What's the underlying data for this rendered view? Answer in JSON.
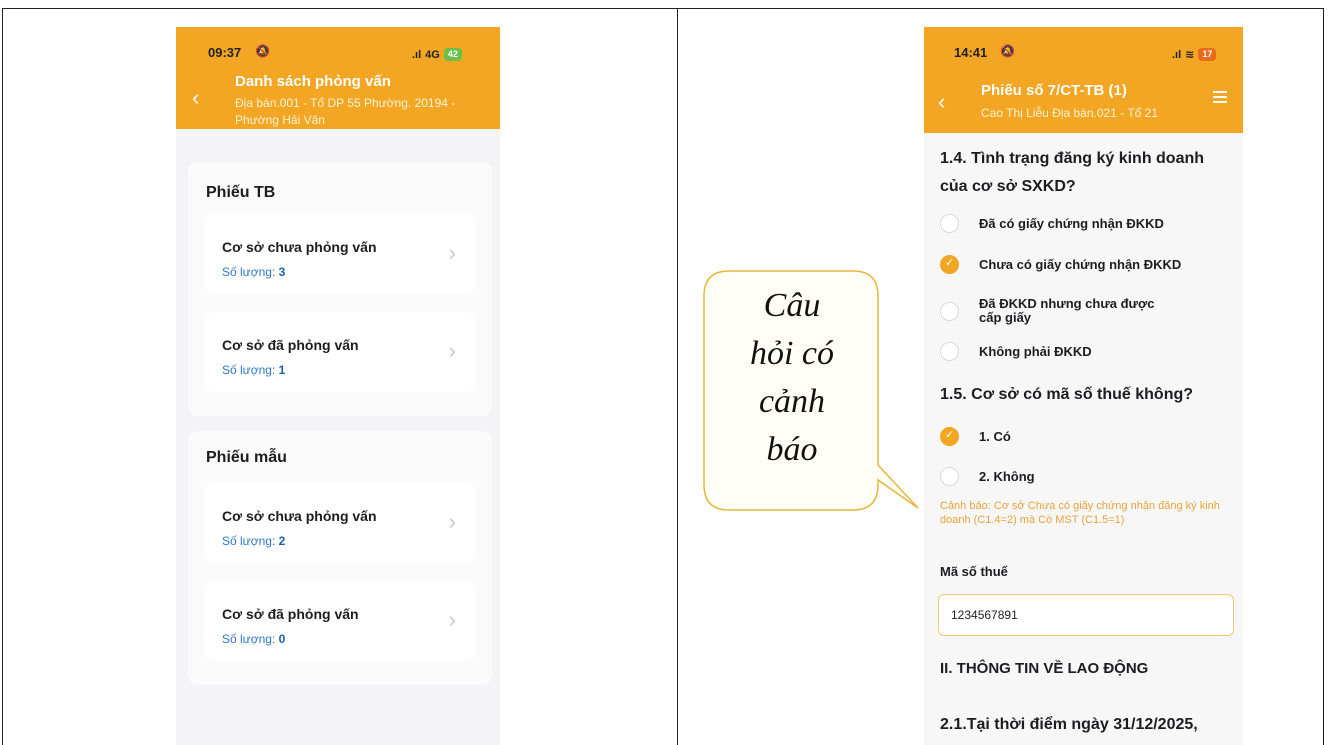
{
  "left_phone": {
    "status_time": "09:37",
    "status_network": "4G",
    "status_battery": "42",
    "title": "Danh sách phỏng vấn",
    "subtitle": "Địa bàn.001 - Tổ DP 55 Phường. 20194 - Phường Hải Vân",
    "groups": [
      {
        "title": "Phiếu TB",
        "items": [
          {
            "title": "Cơ sở chưa phỏng vấn",
            "count_label": "Số lượng:",
            "count": "3"
          },
          {
            "title": "Cơ sở đã phỏng vấn",
            "count_label": "Số lượng:",
            "count": "1"
          }
        ]
      },
      {
        "title": "Phiếu mẫu",
        "items": [
          {
            "title": "Cơ sở chưa phỏng vấn",
            "count_label": "Số lượng:",
            "count": "2"
          },
          {
            "title": "Cơ sở đã phỏng vấn",
            "count_label": "Số lượng:",
            "count": "0"
          }
        ]
      }
    ]
  },
  "right_phone": {
    "status_time": "14:41",
    "status_battery": "17",
    "title": "Phiếu số 7/CT-TB (1)",
    "subtitle": "Cao Thị Liễu Địa bàn.021 - Tổ 21",
    "q14": {
      "text": "1.4. Tình trạng đăng ký kinh doanh của cơ sở SXKD?",
      "options": [
        {
          "label": "Đã có giấy chứng nhận ĐKKD",
          "checked": false
        },
        {
          "label": "Chưa có giấy chứng nhận ĐKKD",
          "checked": true
        },
        {
          "label": "Đã ĐKKD nhưng chưa được cấp giấy",
          "checked": false
        },
        {
          "label": "Không phải ĐKKD",
          "checked": false
        }
      ]
    },
    "q15": {
      "text": "1.5. Cơ sở có mã số thuế không?",
      "options": [
        {
          "label": "1. Có",
          "checked": true
        },
        {
          "label": "2. Không",
          "checked": false
        }
      ]
    },
    "warning": "Cảnh báo: Cơ sở Chưa có giấy chứng nhận đăng ký kinh doanh (C1.4=2) mà Có MST (C1.5=1)",
    "tax_label": "Mã số thuế",
    "tax_value": "1234567891",
    "section_title": "II. THÔNG TIN VỀ LAO ĐỘNG",
    "q21_text": "2.1.Tại thời điểm ngày 31/12/2025,"
  },
  "callout": {
    "line1": "Câu",
    "line2": "hỏi có",
    "line3": "cảnh",
    "line4": "báo"
  },
  "colors": {
    "accent": "#f2a623",
    "warning_text": "#e8a33a",
    "count_blue": "#2d79c7"
  }
}
